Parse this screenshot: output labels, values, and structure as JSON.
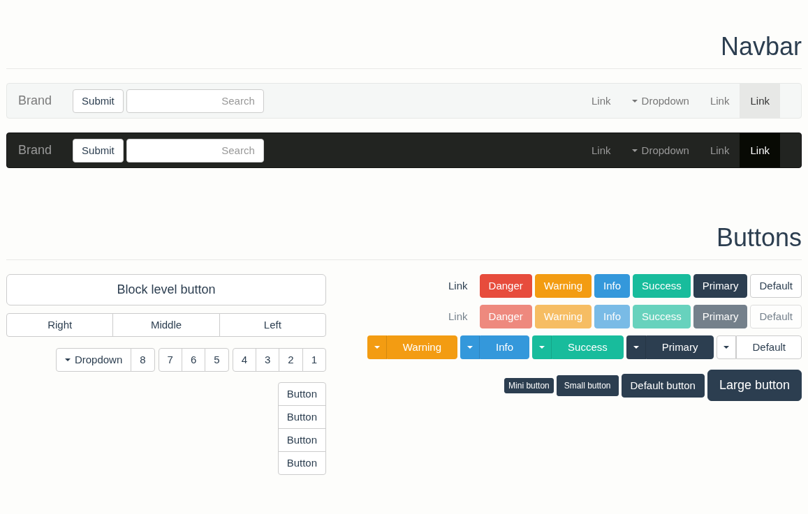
{
  "navbar_section": {
    "title": "Navbar",
    "navbars": [
      {
        "kind": "light",
        "brand": "Brand",
        "submit": "Submit",
        "search_placeholder": "Search",
        "nav": [
          {
            "label": "Link",
            "kind": "link",
            "selected": false
          },
          {
            "label": "Dropdown",
            "kind": "dropdown",
            "selected": false
          },
          {
            "label": "Link",
            "kind": "link",
            "selected": false
          },
          {
            "label": "Link",
            "kind": "link",
            "selected": true
          }
        ]
      },
      {
        "kind": "dark",
        "brand": "Brand",
        "submit": "Submit",
        "search_placeholder": "Search",
        "nav": [
          {
            "label": "Link",
            "kind": "link",
            "selected": false
          },
          {
            "label": "Dropdown",
            "kind": "dropdown",
            "selected": false
          },
          {
            "label": "Link",
            "kind": "link",
            "selected": false
          },
          {
            "label": "Link",
            "kind": "link",
            "selected": true
          }
        ]
      }
    ]
  },
  "buttons_section": {
    "title": "Buttons",
    "block_button": "Block level button",
    "justified": [
      "Right",
      "Middle",
      "Left"
    ],
    "toolbar": [
      [
        {
          "label": "Dropdown",
          "kind": "dropdown"
        },
        {
          "label": "8",
          "kind": "button"
        }
      ],
      [
        {
          "label": "7",
          "kind": "button"
        },
        {
          "label": "6",
          "kind": "button"
        },
        {
          "label": "5",
          "kind": "button"
        }
      ],
      [
        {
          "label": "4",
          "kind": "button"
        },
        {
          "label": "3",
          "kind": "button"
        },
        {
          "label": "2",
          "kind": "button"
        },
        {
          "label": "1",
          "kind": "button"
        }
      ]
    ],
    "vertical": [
      "Button",
      "Button",
      "Button",
      "Button"
    ],
    "button_rows": [
      [
        {
          "label": "Link",
          "kind": "link",
          "disabled": false
        },
        {
          "label": "Danger",
          "kind": "danger",
          "disabled": false
        },
        {
          "label": "Warning",
          "kind": "warning",
          "disabled": false
        },
        {
          "label": "Info",
          "kind": "info",
          "disabled": false
        },
        {
          "label": "Success",
          "kind": "success",
          "disabled": false
        },
        {
          "label": "Primary",
          "kind": "primary",
          "disabled": false
        },
        {
          "label": "Default",
          "kind": "default",
          "disabled": false
        }
      ],
      [
        {
          "label": "Link",
          "kind": "link",
          "disabled": true
        },
        {
          "label": "Danger",
          "kind": "danger",
          "disabled": true
        },
        {
          "label": "Warning",
          "kind": "warning",
          "disabled": true
        },
        {
          "label": "Info",
          "kind": "info",
          "disabled": true
        },
        {
          "label": "Success",
          "kind": "success",
          "disabled": true
        },
        {
          "label": "Primary",
          "kind": "primary",
          "disabled": true
        },
        {
          "label": "Default",
          "kind": "default",
          "disabled": true
        }
      ]
    ],
    "split_buttons": [
      {
        "label": "Warning",
        "kind": "warning"
      },
      {
        "label": "Info",
        "kind": "info"
      },
      {
        "label": "Success",
        "kind": "success"
      },
      {
        "label": "Primary",
        "kind": "primary"
      },
      {
        "label": "Default",
        "kind": "default"
      }
    ],
    "sizes": [
      {
        "label": "Mini button",
        "kind": "mini"
      },
      {
        "label": "Small button",
        "kind": "small"
      },
      {
        "label": "Default button",
        "kind": "default"
      },
      {
        "label": "Large button",
        "kind": "large"
      }
    ]
  }
}
